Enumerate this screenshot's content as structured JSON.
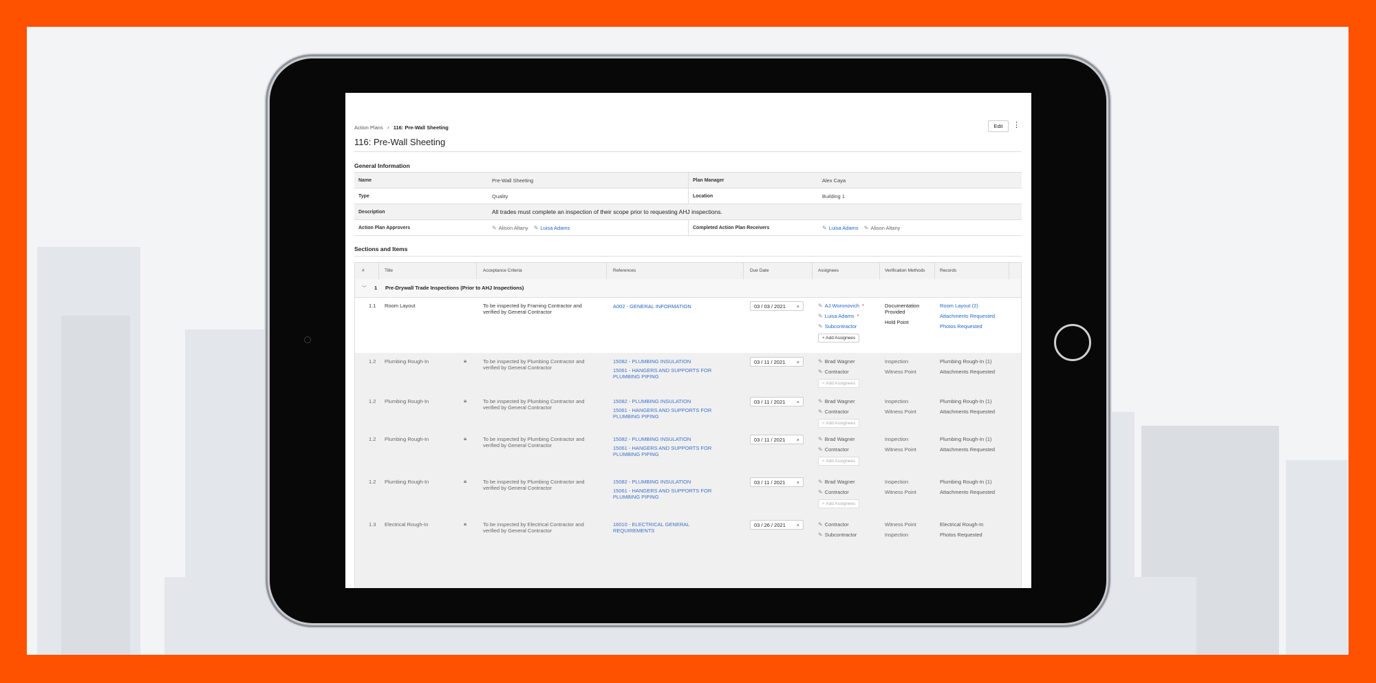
{
  "breadcrumb": {
    "parent": "Action Plans",
    "current": "116: Pre-Wall Sheeting"
  },
  "page_title": "116: Pre-Wall Sheeting",
  "header": {
    "edit_label": "Edit",
    "more_icon": "kebab-menu-icon"
  },
  "general_information": {
    "heading": "General Information",
    "name_label": "Name",
    "name_value": "Pre-Wall Sheeting",
    "plan_manager_label": "Plan Manager",
    "plan_manager_value": "Alex Caya",
    "type_label": "Type",
    "type_value": "Quality",
    "location_label": "Location",
    "location_value": "Building 1",
    "description_label": "Description",
    "description_value": "All trades must complete an inspection of their scope prior to requesting AHJ inspections.",
    "approvers_label": "Action Plan Approvers",
    "approvers": [
      "Alison Altany",
      "Luisa Adams"
    ],
    "receivers_label": "Completed Action Plan Receivers",
    "receivers": [
      "Luisa Adams",
      "Alison Altany"
    ]
  },
  "sections_and_items": {
    "heading": "Sections and Items",
    "columns": [
      "#",
      "Title",
      "Acceptance Criteria",
      "References",
      "Due Date",
      "Assignees",
      "Verification Methods",
      "Records"
    ],
    "section": {
      "number": "1",
      "name": "Pre-Drywall Trade Inspections (Prior to AHJ Inspections)"
    },
    "rows": [
      {
        "num": "1.1",
        "title": "Room Layout",
        "acceptance": "To be inspected by Framing Contractor and verified by General Contractor",
        "refs": [
          "A002 - GENERAL INFORMATION"
        ],
        "due": "03 / 03 / 2021",
        "assignees": [
          "AJ Woronovich",
          "Luisa Adams",
          "Subcontractor"
        ],
        "add_label": "Add Assignees",
        "verification": [
          "Documentation Provided",
          "Hold Point"
        ],
        "records": [
          "Room Layout (2)",
          "Attachments Requested",
          "Photos Requested"
        ]
      },
      {
        "num": "1.2",
        "title": "Plumbing Rough-In",
        "acceptance": "To be inspected by Plumbing Contractor and verified by General Contractor",
        "refs": [
          "15082 - PLUMBING INSULATION",
          "15061 - HANGERS AND SUPPORTS FOR PLUMBING PIPING"
        ],
        "due": "03 / 11 / 2021",
        "assignees": [
          "Brad Wagner",
          "Contractor"
        ],
        "add_label": "Add Assignees",
        "verification": [
          "Inspection",
          "Witness Point"
        ],
        "records": [
          "Plumbing Rough-In (1)",
          "Attachments Requested"
        ]
      },
      {
        "num": "1.2",
        "title": "Plumbing Rough-In",
        "acceptance": "To be inspected by Plumbing Contractor and verified by General Contractor",
        "refs": [
          "15082 - PLUMBING INSULATION",
          "15061 - HANGERS AND SUPPORTS FOR PLUMBING PIPING"
        ],
        "due": "03 / 11 / 2021",
        "assignees": [
          "Brad Wagner",
          "Contractor"
        ],
        "add_label": "Add Assignees",
        "verification": [
          "Inspection",
          "Witness Point"
        ],
        "records": [
          "Plumbing Rough-In (1)",
          "Attachments Requested"
        ]
      },
      {
        "num": "1.2",
        "title": "Plumbing Rough-In",
        "acceptance": "To be inspected by Plumbing Contractor and verified by General Contractor",
        "refs": [
          "15082 - PLUMBING INSULATION",
          "15061 - HANGERS AND SUPPORTS FOR PLUMBING PIPING"
        ],
        "due": "03 / 11 / 2021",
        "assignees": [
          "Brad Wagner",
          "Contractor"
        ],
        "add_label": "Add Assignees",
        "verification": [
          "Inspection",
          "Witness Point"
        ],
        "records": [
          "Plumbing Rough-In (1)",
          "Attachments Requested"
        ]
      },
      {
        "num": "1.2",
        "title": "Plumbing Rough-In",
        "acceptance": "To be inspected by Plumbing Contractor and verified by General Contractor",
        "refs": [
          "15082 - PLUMBING INSULATION",
          "15061 - HANGERS AND SUPPORTS FOR PLUMBING PIPING"
        ],
        "due": "03 / 11 / 2021",
        "assignees": [
          "Brad Wagner",
          "Contractor"
        ],
        "add_label": "Add Assignees",
        "verification": [
          "Inspection",
          "Witness Point"
        ],
        "records": [
          "Plumbing Rough-In (1)",
          "Attachments Requested"
        ]
      },
      {
        "num": "1.3",
        "title": "Electrical Rough-In",
        "acceptance": "To be inspected by Electrical Contractor and verified by General Contractor",
        "refs": [
          "16010 - ELECTRICAL GENERAL REQUIREMENTS"
        ],
        "due": "03 / 26 / 2021",
        "assignees": [
          "Contractor",
          "Subcontractor"
        ],
        "add_label": "",
        "verification": [
          "Witness Point",
          "Inspection"
        ],
        "records": [
          "Electrical Rough-In",
          "Photos Requested"
        ]
      }
    ]
  },
  "colors": {
    "frame": "#FF5200",
    "link": "#2066C8",
    "required": "#D0312D"
  }
}
